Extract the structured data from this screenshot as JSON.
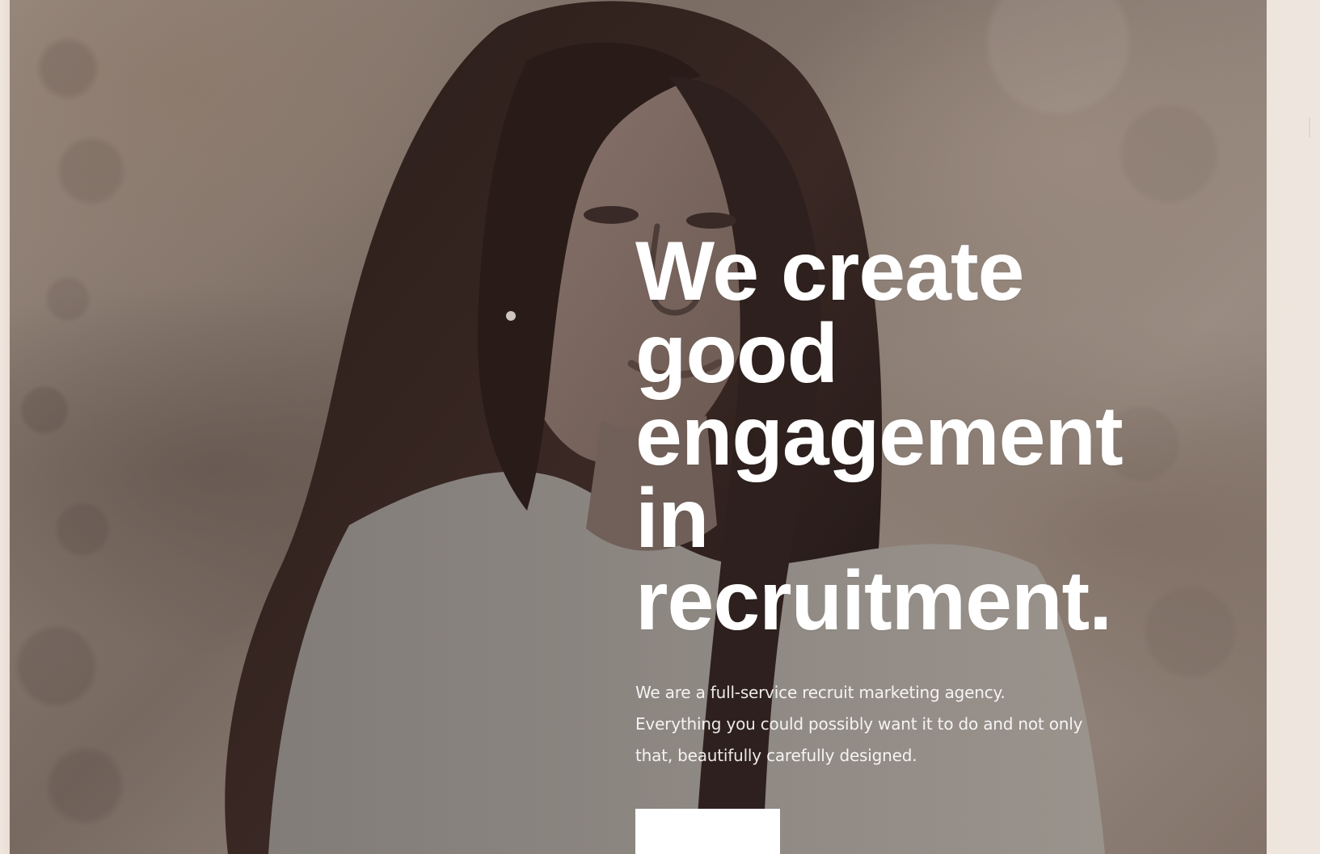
{
  "hero": {
    "headline_lines": [
      "We create",
      "good",
      "engagement",
      "in",
      "recruitment."
    ],
    "subtext_lines": [
      "We are a full-service recruit marketing agency.",
      "Everything you could possibly want it to do and not only",
      "that, beautifully carefully designed."
    ],
    "cta_label": ""
  },
  "colors": {
    "headline": "#ffffff",
    "subtext": "#ffffff",
    "button": "#ffffff"
  }
}
